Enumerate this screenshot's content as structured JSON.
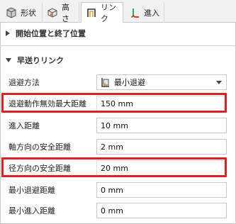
{
  "tabs": [
    {
      "label": "形状",
      "icon": "shape-icon"
    },
    {
      "label": "高さ",
      "icon": "height-icon"
    },
    {
      "label": "リンク",
      "icon": "link-icon",
      "active": true
    },
    {
      "label": "進入",
      "icon": "entry-icon"
    }
  ],
  "sections": {
    "start_end": {
      "title": "開始位置と終了位置",
      "expanded": false
    },
    "rapid_link": {
      "title": "早送りリンク",
      "expanded": true
    }
  },
  "fields": {
    "retract_method": {
      "label": "退避方法",
      "value": "最小退避"
    },
    "max_retract_distance": {
      "label": "退避動作無効最大距離",
      "value": "150 mm"
    },
    "entry_distance": {
      "label": "進入距離",
      "value": "10 mm"
    },
    "axial_safe_distance": {
      "label": "軸方向の安全距離",
      "value": "2 mm"
    },
    "radial_safe_distance": {
      "label": "径方向の安全距離",
      "value": "20 mm"
    },
    "min_retract_distance": {
      "label": "最小退避距離",
      "value": "0 mm"
    },
    "min_entry_distance": {
      "label": "最小進入距離",
      "value": "0 mm"
    }
  },
  "colors": {
    "highlight": "#e02020"
  }
}
